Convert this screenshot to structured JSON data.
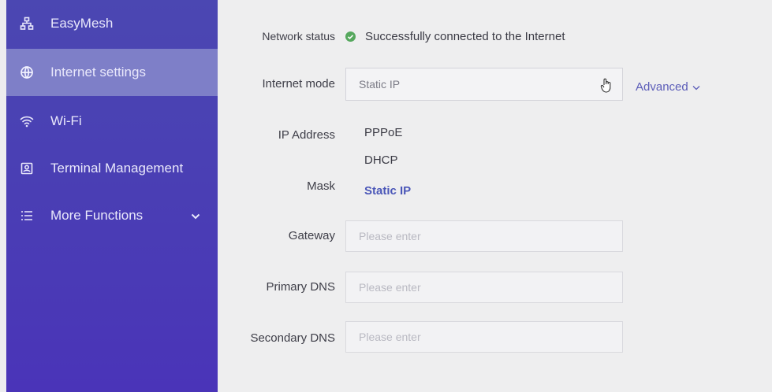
{
  "sidebar": {
    "items": [
      {
        "label": "EasyMesh",
        "icon": "mesh-icon"
      },
      {
        "label": "Internet settings",
        "icon": "globe-icon"
      },
      {
        "label": "Wi-Fi",
        "icon": "wifi-icon"
      },
      {
        "label": "Terminal Management",
        "icon": "terminal-icon"
      },
      {
        "label": "More Functions",
        "icon": "list-icon"
      }
    ],
    "active_index": 1
  },
  "form": {
    "network_status_label": "Network status",
    "network_status_value": "Successfully connected to the Internet",
    "internet_mode_label": "Internet mode",
    "internet_mode_value": "Static IP",
    "advanced_label": "Advanced",
    "ip_address_label": "IP Address",
    "mask_label": "Mask",
    "gateway_label": "Gateway",
    "gateway_placeholder": "Please enter",
    "primary_dns_label": "Primary DNS",
    "primary_dns_placeholder": "Please enter",
    "secondary_dns_label": "Secondary DNS",
    "secondary_dns_placeholder": "Please enter"
  },
  "mode_options": [
    "PPPoE",
    "DHCP",
    "Static IP"
  ],
  "selected_mode": "Static IP",
  "colors": {
    "sidebar": "#4a40b5",
    "active_item": "#7e7fc8",
    "accent": "#4a56b8",
    "status_ok": "#56a85e"
  }
}
